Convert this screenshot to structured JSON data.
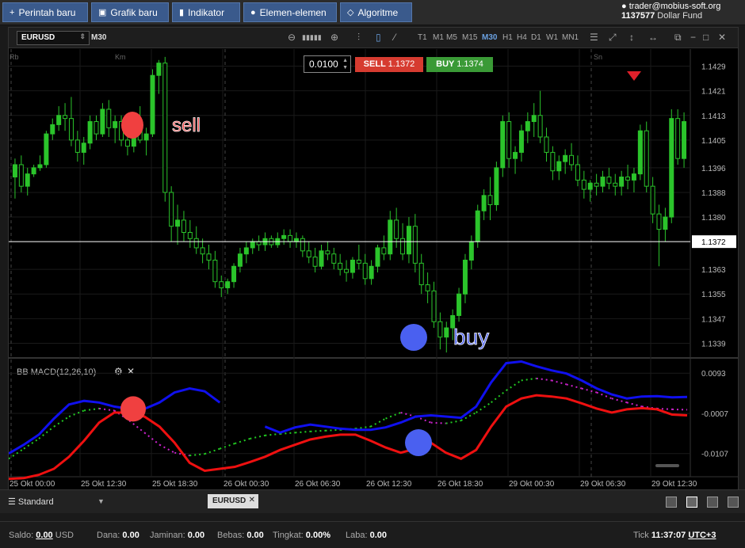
{
  "toolbar": {
    "buttons": [
      {
        "label": "Perintah baru",
        "icon": "plus-icon"
      },
      {
        "label": "Grafik baru",
        "icon": "chart-icon"
      },
      {
        "label": "Indikator",
        "icon": "bars-icon"
      },
      {
        "label": "Elemen-elemen",
        "icon": "shapes-icon"
      },
      {
        "label": "Algoritme",
        "icon": "diamond-icon"
      }
    ]
  },
  "account": {
    "email": "trader@mobius-soft.org",
    "number": "1137577",
    "fund": "Dollar Fund"
  },
  "chart": {
    "symbol": "EURUSD",
    "timeframe": "M30",
    "timeframes": [
      "T1",
      "M1",
      "M5",
      "M15",
      "M30",
      "H1",
      "H4",
      "D1",
      "W1",
      "MN1"
    ],
    "active_timeframe": "M30",
    "lot": "0.0100",
    "sell_label": "SELL",
    "sell_price": "1.1372",
    "buy_label": "BUY",
    "buy_price": "1.1374",
    "current_price": "1.1372",
    "day_labels": [
      "Rb",
      "Km",
      "Sn"
    ],
    "price_ticks": [
      "1.1429",
      "1.1421",
      "1.1413",
      "1.1405",
      "1.1396",
      "1.1388",
      "1.1380",
      "1.1363",
      "1.1355",
      "1.1347",
      "1.1339"
    ],
    "indicator_title": "BB MACD(12,26,10)",
    "macd_ticks": [
      "0.0093",
      "-0.0007",
      "-0.0107"
    ],
    "time_labels": [
      "25 Okt 00:00",
      "25 Okt 12:30",
      "25 Okt 18:30",
      "26 Okt 00:30",
      "26 Okt 06:30",
      "26 Okt 12:30",
      "26 Okt 18:30",
      "29 Okt 00:30",
      "29 Okt 06:30",
      "29 Okt 12:30"
    ],
    "annotations": {
      "sell": "sell",
      "buy": "buy"
    },
    "colors": {
      "bull": "#2bc42b",
      "bear": "#2bc42b",
      "sell_marker": "#f04040",
      "buy_marker": "#4a60f0",
      "macd_blue": "#1010ee",
      "macd_red": "#ee1010",
      "signal_green": "#22cc22",
      "signal_magenta": "#cc22cc"
    }
  },
  "bottom": {
    "profile": "Standard",
    "tab": "EURUSD"
  },
  "status": {
    "saldo_label": "Saldo:",
    "saldo": "0.00",
    "currency": "USD",
    "dana_label": "Dana:",
    "dana": "0.00",
    "jaminan_label": "Jaminan:",
    "jaminan": "0.00",
    "bebas_label": "Bebas:",
    "bebas": "0.00",
    "tingkat_label": "Tingkat:",
    "tingkat": "0.00%",
    "laba_label": "Laba:",
    "laba": "0.00",
    "tick_label": "Tick",
    "time": "11:37:07",
    "tz": "UTC+3"
  },
  "chart_data": {
    "type": "candlestick",
    "price_axis": {
      "min": 1.1335,
      "max": 1.1433
    },
    "candles": [
      [
        1.1393,
        1.1399,
        1.1386,
        1.1397
      ],
      [
        1.1397,
        1.14,
        1.1388,
        1.139
      ],
      [
        1.139,
        1.1396,
        1.1387,
        1.1394
      ],
      [
        1.1394,
        1.1397,
        1.1393,
        1.1396
      ],
      [
        1.1396,
        1.14,
        1.1395,
        1.1397
      ],
      [
        1.1397,
        1.1408,
        1.1396,
        1.1407
      ],
      [
        1.1407,
        1.1412,
        1.1405,
        1.141
      ],
      [
        1.141,
        1.1416,
        1.1408,
        1.1413
      ],
      [
        1.1413,
        1.1417,
        1.1408,
        1.1412
      ],
      [
        1.1412,
        1.1419,
        1.1403,
        1.1405
      ],
      [
        1.1405,
        1.1408,
        1.1398,
        1.1401
      ],
      [
        1.1401,
        1.1406,
        1.1397,
        1.1404
      ],
      [
        1.1404,
        1.1413,
        1.1402,
        1.1411
      ],
      [
        1.1411,
        1.1413,
        1.1405,
        1.1407
      ],
      [
        1.1407,
        1.1417,
        1.1406,
        1.1415
      ],
      [
        1.1415,
        1.1418,
        1.1406,
        1.1409
      ],
      [
        1.1409,
        1.1413,
        1.1404,
        1.1411
      ],
      [
        1.1411,
        1.1413,
        1.1403,
        1.1405
      ],
      [
        1.1405,
        1.1408,
        1.14,
        1.1403
      ],
      [
        1.1403,
        1.1412,
        1.1401,
        1.141
      ],
      [
        1.141,
        1.1416,
        1.1404,
        1.1405
      ],
      [
        1.1405,
        1.1409,
        1.14,
        1.1407
      ],
      [
        1.1407,
        1.1428,
        1.1406,
        1.1426
      ],
      [
        1.1426,
        1.1431,
        1.142,
        1.143
      ],
      [
        1.143,
        1.1432,
        1.1385,
        1.1388
      ],
      [
        1.1388,
        1.139,
        1.1372,
        1.1377
      ],
      [
        1.1377,
        1.1384,
        1.1371,
        1.1379
      ],
      [
        1.1379,
        1.1382,
        1.1372,
        1.1375
      ],
      [
        1.1375,
        1.1379,
        1.137,
        1.1373
      ],
      [
        1.1373,
        1.1377,
        1.1368,
        1.137
      ],
      [
        1.137,
        1.1373,
        1.1365,
        1.1368
      ],
      [
        1.1368,
        1.1371,
        1.1363,
        1.1366
      ],
      [
        1.1366,
        1.1369,
        1.1357,
        1.1359
      ],
      [
        1.1359,
        1.1361,
        1.1354,
        1.1357
      ],
      [
        1.1357,
        1.136,
        1.1355,
        1.1359
      ],
      [
        1.1359,
        1.1365,
        1.1357,
        1.1364
      ],
      [
        1.1364,
        1.137,
        1.1362,
        1.1368
      ],
      [
        1.1368,
        1.1372,
        1.1365,
        1.137
      ],
      [
        1.137,
        1.1373,
        1.1368,
        1.1372
      ],
      [
        1.1372,
        1.1374,
        1.1369,
        1.1371
      ],
      [
        1.1371,
        1.1375,
        1.1369,
        1.1373
      ],
      [
        1.1373,
        1.1374,
        1.137,
        1.1371
      ],
      [
        1.1371,
        1.1375,
        1.137,
        1.1373
      ],
      [
        1.1373,
        1.1376,
        1.1371,
        1.1374
      ],
      [
        1.1374,
        1.1376,
        1.137,
        1.1372
      ],
      [
        1.1372,
        1.1375,
        1.137,
        1.1373
      ],
      [
        1.1373,
        1.1374,
        1.1367,
        1.1369
      ],
      [
        1.1369,
        1.1372,
        1.1365,
        1.1367
      ],
      [
        1.1367,
        1.137,
        1.1362,
        1.1364
      ],
      [
        1.1364,
        1.1371,
        1.1363,
        1.1369
      ],
      [
        1.1369,
        1.1372,
        1.1366,
        1.1368
      ],
      [
        1.1368,
        1.137,
        1.1363,
        1.1365
      ],
      [
        1.1365,
        1.1368,
        1.1361,
        1.1363
      ],
      [
        1.1363,
        1.1366,
        1.1359,
        1.1362
      ],
      [
        1.1362,
        1.1367,
        1.136,
        1.1366
      ],
      [
        1.1366,
        1.1371,
        1.1363,
        1.1365
      ],
      [
        1.1365,
        1.1368,
        1.1358,
        1.136
      ],
      [
        1.136,
        1.1366,
        1.1358,
        1.1364
      ],
      [
        1.1364,
        1.1371,
        1.1362,
        1.137
      ],
      [
        1.137,
        1.1374,
        1.1366,
        1.1368
      ],
      [
        1.1368,
        1.1382,
        1.1366,
        1.1379
      ],
      [
        1.1379,
        1.1383,
        1.137,
        1.1373
      ],
      [
        1.1373,
        1.1378,
        1.1366,
        1.1368
      ],
      [
        1.1368,
        1.138,
        1.1365,
        1.1377
      ],
      [
        1.1377,
        1.1381,
        1.1362,
        1.1365
      ],
      [
        1.1365,
        1.1368,
        1.1355,
        1.1358
      ],
      [
        1.1358,
        1.1362,
        1.1352,
        1.1356
      ],
      [
        1.1356,
        1.1359,
        1.1344,
        1.1346
      ],
      [
        1.1346,
        1.1349,
        1.1337,
        1.1341
      ],
      [
        1.1341,
        1.1346,
        1.1336,
        1.1344
      ],
      [
        1.1344,
        1.135,
        1.134,
        1.1348
      ],
      [
        1.1348,
        1.1357,
        1.1346,
        1.1355
      ],
      [
        1.1355,
        1.1368,
        1.1352,
        1.1366
      ],
      [
        1.1366,
        1.1374,
        1.1363,
        1.1372
      ],
      [
        1.1372,
        1.1384,
        1.137,
        1.1382
      ],
      [
        1.1382,
        1.1389,
        1.1379,
        1.1387
      ],
      [
        1.1387,
        1.1393,
        1.1379,
        1.1384
      ],
      [
        1.1384,
        1.1398,
        1.1382,
        1.1396
      ],
      [
        1.1396,
        1.1413,
        1.1393,
        1.1411
      ],
      [
        1.1411,
        1.1414,
        1.1396,
        1.1399
      ],
      [
        1.1399,
        1.1403,
        1.1394,
        1.1401
      ],
      [
        1.1401,
        1.141,
        1.1398,
        1.1408
      ],
      [
        1.1408,
        1.1414,
        1.1404,
        1.1411
      ],
      [
        1.1411,
        1.1417,
        1.1406,
        1.1413
      ],
      [
        1.1413,
        1.1421,
        1.1404,
        1.1406
      ],
      [
        1.1406,
        1.1409,
        1.1398,
        1.1401
      ],
      [
        1.1401,
        1.1403,
        1.1392,
        1.1395
      ],
      [
        1.1395,
        1.14,
        1.1392,
        1.1398
      ],
      [
        1.1398,
        1.1402,
        1.1394,
        1.14
      ],
      [
        1.14,
        1.1404,
        1.1395,
        1.1397
      ],
      [
        1.1397,
        1.14,
        1.139,
        1.1392
      ],
      [
        1.1392,
        1.1395,
        1.1386,
        1.1389
      ],
      [
        1.1389,
        1.1392,
        1.1385,
        1.1391
      ],
      [
        1.1391,
        1.1394,
        1.1387,
        1.139
      ],
      [
        1.139,
        1.1395,
        1.1388,
        1.1393
      ],
      [
        1.1393,
        1.1396,
        1.1389,
        1.1391
      ],
      [
        1.1391,
        1.1394,
        1.1387,
        1.139
      ],
      [
        1.139,
        1.1395,
        1.1387,
        1.1393
      ],
      [
        1.1393,
        1.1397,
        1.1389,
        1.1392
      ],
      [
        1.1392,
        1.1396,
        1.1388,
        1.1394
      ],
      [
        1.1394,
        1.141,
        1.1392,
        1.1408
      ],
      [
        1.1408,
        1.1411,
        1.1388,
        1.139
      ],
      [
        1.139,
        1.1393,
        1.1378,
        1.1381
      ],
      [
        1.1381,
        1.1384,
        1.1364,
        1.1376
      ],
      [
        1.1376,
        1.1383,
        1.1372,
        1.138
      ],
      [
        1.138,
        1.1415,
        1.1378,
        1.1412
      ],
      [
        1.1412,
        1.1415,
        1.1397,
        1.1399
      ],
      [
        1.1399,
        1.1414,
        1.1396,
        1.1411
      ]
    ],
    "macd_axis": {
      "min": -0.0145,
      "max": 0.0125
    },
    "macd_series": [
      {
        "name": "BB MACD upper",
        "color": "#1010ee",
        "values": [
          -0.0107,
          -0.0085,
          -0.006,
          -0.002,
          0.0015,
          0.0024,
          0.002,
          0.001,
          0.0004,
          0.0004,
          0.002,
          0.0045,
          0.0055,
          0.0048,
          0.002,
          null,
          null,
          -0.004,
          -0.0055,
          -0.0042,
          -0.0035,
          -0.004,
          -0.0045,
          -0.0048,
          -0.0048,
          -0.0042,
          -0.003,
          -0.0015,
          -0.0012,
          -0.0015,
          -0.0018,
          0.001,
          0.007,
          0.0118,
          0.0122,
          0.011,
          0.01,
          0.0092,
          0.0075,
          0.0055,
          0.004,
          0.003,
          0.0035,
          0.0036,
          0.0033,
          0.0034
        ]
      },
      {
        "name": "BB MACD lower",
        "color": "#ee1010",
        "values": [
          -0.017,
          -0.0168,
          -0.016,
          -0.0145,
          -0.0115,
          -0.0075,
          -0.003,
          -0.0005,
          -0.0005,
          -0.0015,
          -0.004,
          -0.008,
          -0.013,
          -0.015,
          -0.0145,
          -0.014,
          -0.0128,
          -0.0115,
          -0.0098,
          -0.0085,
          -0.0072,
          -0.0065,
          -0.006,
          -0.006,
          -0.0075,
          -0.0092,
          -0.0105,
          -0.0095,
          -0.008,
          -0.0105,
          -0.012,
          -0.0098,
          -0.004,
          0.001,
          0.003,
          0.0038,
          0.0035,
          0.003,
          0.0018,
          0.0005,
          -0.0005,
          0.0003,
          0.0006,
          0.0003,
          -0.001,
          -0.0012
        ]
      },
      {
        "name": "Signal",
        "color": "#22cc22",
        "values": [
          -0.012,
          -0.0095,
          -0.007,
          -0.004,
          -0.0015,
          0.0,
          0.0005,
          0.0,
          -0.0025,
          -0.0055,
          -0.0085,
          -0.0105,
          -0.0112,
          -0.0108,
          -0.0095,
          -0.0082,
          -0.007,
          -0.0062,
          -0.0058,
          -0.0055,
          -0.0052,
          -0.005,
          -0.0048,
          -0.0045,
          -0.004,
          -0.002,
          -0.0005,
          -0.0015,
          -0.003,
          -0.0032,
          -0.0025,
          -0.0005,
          0.002,
          0.005,
          0.0075,
          0.008,
          0.0075,
          0.0065,
          0.0055,
          0.0045,
          0.003,
          0.002,
          0.001,
          0.0005,
          0.0003,
          0.0002
        ]
      }
    ]
  }
}
